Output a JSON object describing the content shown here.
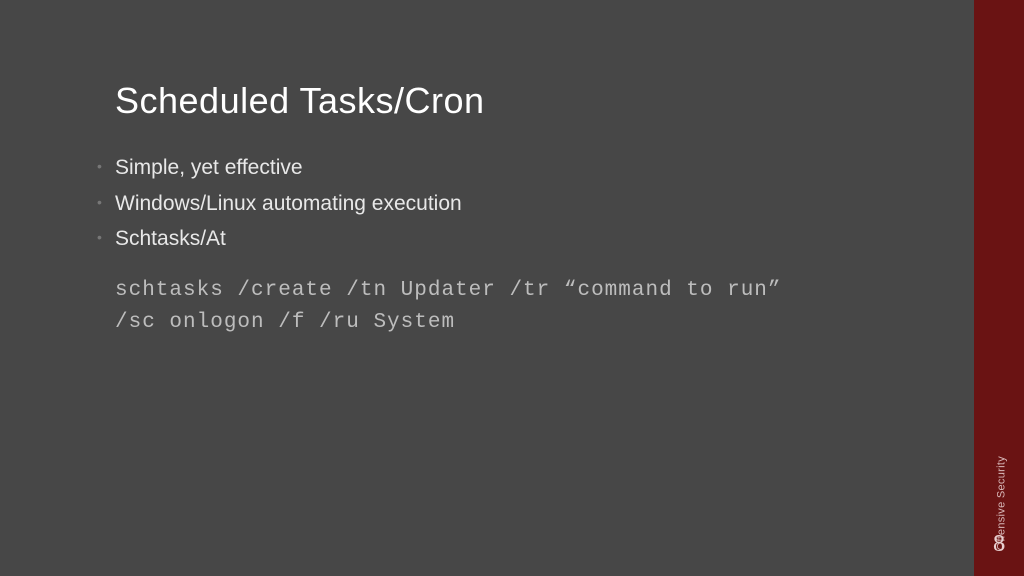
{
  "slide": {
    "title": "Scheduled Tasks/Cron",
    "bullets": [
      "Simple, yet effective",
      "Windows/Linux automating execution",
      "Schtasks/At"
    ],
    "code": "schtasks /create /tn Updater /tr “command to run” /sc onlogon /f /ru System"
  },
  "sidebar": {
    "label": "Offensive Security",
    "page_number": "8"
  }
}
